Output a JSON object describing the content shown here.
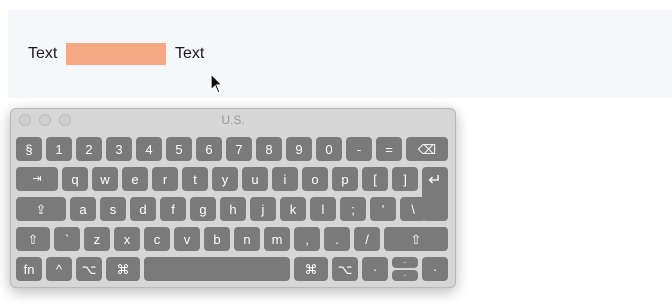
{
  "demo": {
    "left_text": "Text",
    "right_text": "Text"
  },
  "keyboard": {
    "title": "U.S.",
    "row1": [
      "§",
      "1",
      "2",
      "3",
      "4",
      "5",
      "6",
      "7",
      "8",
      "9",
      "0",
      "-",
      "=",
      "⌫"
    ],
    "row2": [
      "⇥",
      "q",
      "w",
      "e",
      "r",
      "t",
      "y",
      "u",
      "i",
      "o",
      "p",
      "[",
      "]",
      "↵"
    ],
    "row3": [
      "⇪",
      "a",
      "s",
      "d",
      "f",
      "g",
      "h",
      "j",
      "k",
      "l",
      ";",
      "'",
      "\\"
    ],
    "row4": [
      "⇧",
      "`",
      "z",
      "x",
      "c",
      "v",
      "b",
      "n",
      "m",
      ",",
      ".",
      "/",
      "⇧"
    ],
    "row5": {
      "fn": "fn",
      "ctrl": "^",
      "option_left": "⌥",
      "cmd_left": "⌘",
      "space": "",
      "cmd_right": "⌘",
      "option_right": "⌥",
      "arrow_left": "·",
      "arrow_up": "·",
      "arrow_down": "·",
      "arrow_right": "·"
    }
  }
}
